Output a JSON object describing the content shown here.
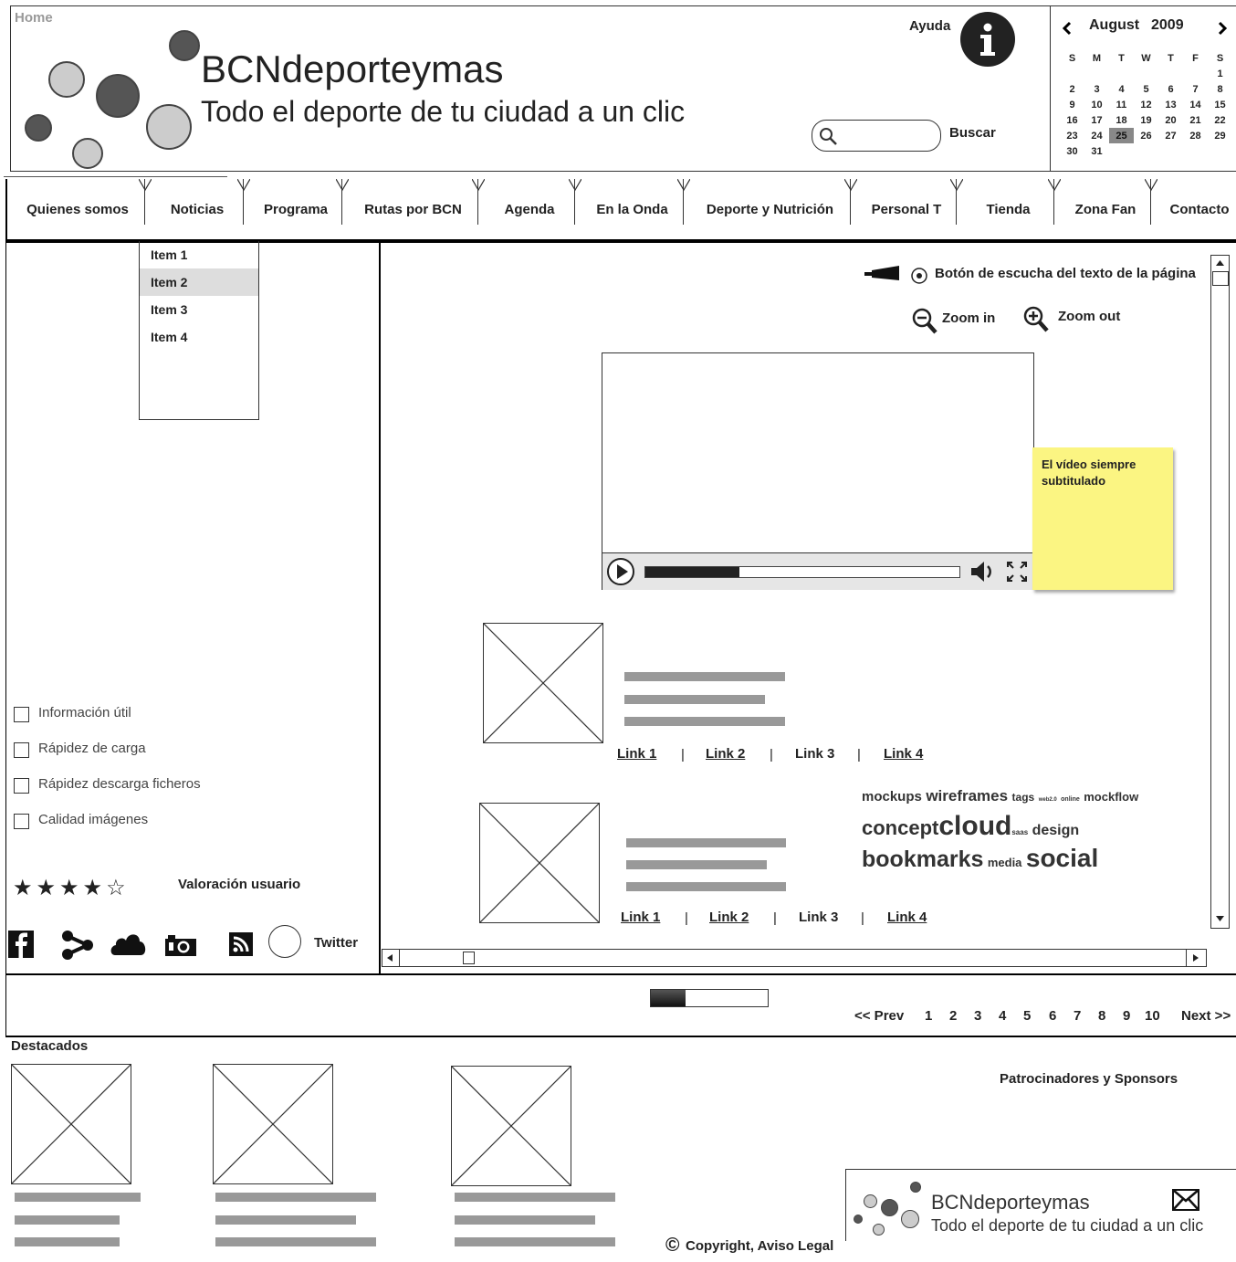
{
  "header": {
    "home": "Home",
    "title": "BCNdeporteymas",
    "subtitle": "Todo el deporte de tu ciudad a un clic",
    "help": "Ayuda",
    "search_placeholder": "",
    "search_button": "Buscar"
  },
  "calendar": {
    "month": "August",
    "year": "2009",
    "weekdays": [
      "S",
      "M",
      "T",
      "W",
      "T",
      "F",
      "S"
    ],
    "weeks": [
      [
        "",
        "",
        "",
        "",
        "",
        "",
        "1"
      ],
      [
        "2",
        "3",
        "4",
        "5",
        "6",
        "7",
        "8"
      ],
      [
        "9",
        "10",
        "11",
        "12",
        "13",
        "14",
        "15"
      ],
      [
        "16",
        "17",
        "18",
        "19",
        "20",
        "21",
        "22"
      ],
      [
        "23",
        "24",
        "25",
        "26",
        "27",
        "28",
        "29"
      ],
      [
        "30",
        "31",
        "",
        "",
        "",
        "",
        ""
      ]
    ],
    "selected": "25"
  },
  "tabs": [
    "Quienes somos",
    "Noticias",
    "Programa",
    "Rutas por BCN",
    "Agenda",
    "En la Onda",
    "Deporte y Nutrición",
    "Personal T",
    "Tienda",
    "Zona Fan",
    "Contacto"
  ],
  "dropdown": [
    "Item 1",
    "Item 2",
    "Item 3",
    "Item 4"
  ],
  "feedback": [
    "Información útil",
    "Rápidez de carga",
    "Rápidez descarga ficheros",
    "Calidad imágenes"
  ],
  "rating": {
    "stars": 4,
    "max": 5,
    "label": "Valoración usuario"
  },
  "social": {
    "twitter": "Twitter"
  },
  "main": {
    "listen": "Botón de escucha del texto de la página",
    "zoom_in": "Zoom in",
    "zoom_out": "Zoom out",
    "video_progress": 0.3,
    "note": "El vídeo siempre subtitulado",
    "links": [
      "Link 1",
      "Link 2",
      "Link 3",
      "Link 4"
    ],
    "link_sep": "|"
  },
  "tagcloud": {
    "line1": [
      "mockups",
      "wireframes",
      "tags",
      "web2.0",
      "online",
      "mockflow"
    ],
    "line2": [
      "concept",
      "cloud",
      "saas",
      "design"
    ],
    "line3": [
      "bookmarks",
      "media",
      "social"
    ]
  },
  "pagination": {
    "prev": "<< Prev",
    "pages": [
      "1",
      "2",
      "3",
      "4",
      "5",
      "6",
      "7",
      "8",
      "9",
      "10"
    ],
    "next": "Next >>"
  },
  "footer": {
    "featured": "Destacados",
    "sponsors": "Patrocinadores y Sponsors",
    "copyright": "Copyright, Aviso Legal",
    "copy_symbol": "©",
    "brand": "BCNdeporteymas",
    "brand_sub": "Todo el deporte de tu ciudad a un clic"
  }
}
